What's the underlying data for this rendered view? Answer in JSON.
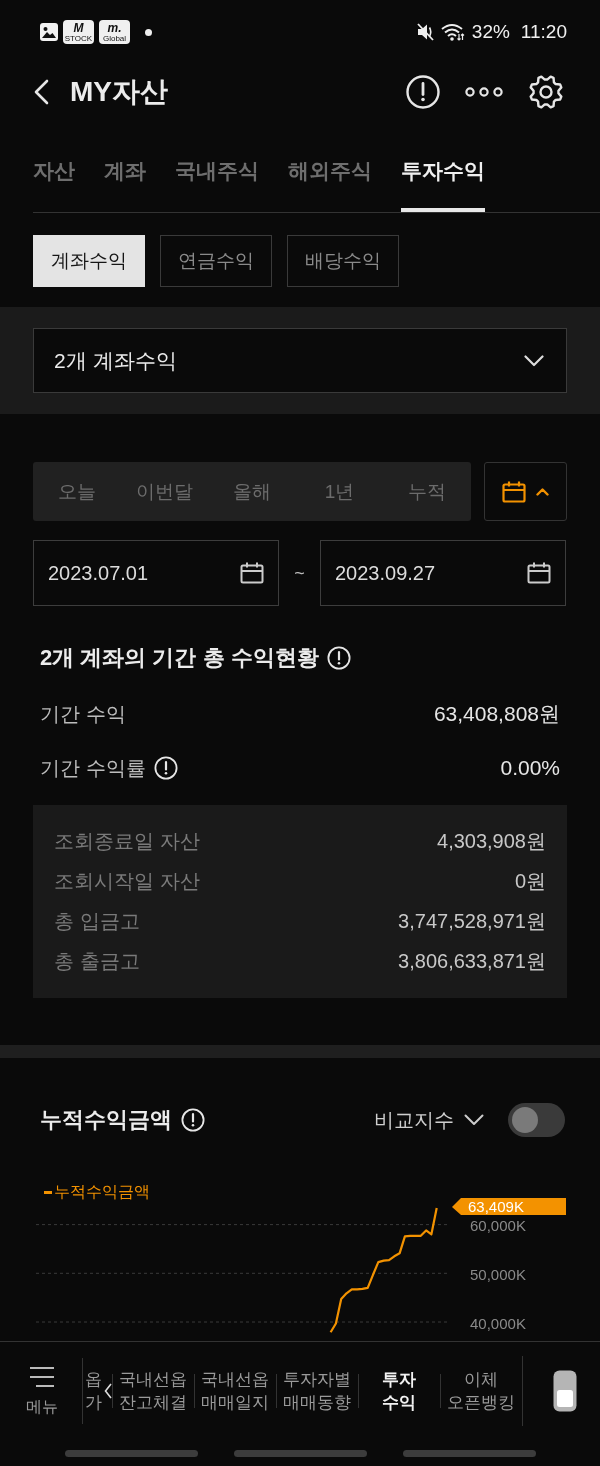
{
  "status_bar": {
    "notification_icons": [
      {
        "kind": "gallery"
      },
      {
        "kind": "app",
        "title": "M",
        "subtitle": "STOCK"
      },
      {
        "kind": "app",
        "title": "m.",
        "subtitle": "Global"
      },
      {
        "kind": "dot"
      }
    ],
    "battery": "32%",
    "time": "11:20"
  },
  "header": {
    "title": "MY자산"
  },
  "tabs": [
    {
      "label": "자산",
      "selected": false
    },
    {
      "label": "계좌",
      "selected": false
    },
    {
      "label": "국내주식",
      "selected": false
    },
    {
      "label": "해외주식",
      "selected": false
    },
    {
      "label": "투자수익",
      "selected": true
    }
  ],
  "sub_tabs": [
    {
      "label": "계좌수익",
      "selected": true
    },
    {
      "label": "연금수익",
      "selected": false
    },
    {
      "label": "배당수익",
      "selected": false
    }
  ],
  "account_dropdown": {
    "value": "2개 계좌수익"
  },
  "period": {
    "options": [
      {
        "label": "오늘",
        "selected": false
      },
      {
        "label": "이번달",
        "selected": false
      },
      {
        "label": "올해",
        "selected": false
      },
      {
        "label": "1년",
        "selected": false
      },
      {
        "label": "누적",
        "selected": false
      }
    ],
    "calendar_toggle": {
      "expanded": true
    },
    "start_date": "2023.07.01",
    "separator": "~",
    "end_date": "2023.09.27"
  },
  "summary": {
    "title": "2개 계좌의 기간 총 수익현황",
    "rows": [
      {
        "label": "기간 수익",
        "value": "63,408,808원",
        "info": false
      },
      {
        "label": "기간 수익률",
        "value": "0.00%",
        "info": true
      }
    ],
    "details": [
      {
        "label": "조회종료일 자산",
        "value": "4,303,908원"
      },
      {
        "label": "조회시작일 자산",
        "value": "0원"
      },
      {
        "label": "총 입금고",
        "value": "3,747,528,971원"
      },
      {
        "label": "총 출금고",
        "value": "3,806,633,871원"
      }
    ]
  },
  "chart_section": {
    "title": "누적수익금액",
    "compare": {
      "label": "비교지수",
      "on": false
    },
    "chart_data": {
      "type": "line",
      "categories": [
        null,
        null,
        null,
        null,
        null,
        null,
        null,
        null,
        null,
        null,
        null,
        null,
        null,
        null,
        null,
        null,
        null,
        null,
        null,
        null,
        null,
        null,
        null,
        null,
        null,
        null,
        null,
        null,
        null,
        null,
        null,
        null,
        null,
        null,
        null,
        null,
        null,
        null,
        null,
        null,
        null,
        null,
        null,
        null,
        null,
        null,
        null,
        null,
        null,
        null,
        null,
        null,
        null,
        null,
        null,
        null,
        null,
        null,
        null,
        null,
        null,
        null,
        null,
        null,
        null,
        null,
        null,
        null,
        null,
        null,
        null,
        null,
        null,
        null,
        null,
        null,
        null,
        null
      ],
      "series": [
        {
          "name": "누적수익금액",
          "color": "#f39200",
          "values": [
            null,
            null,
            null,
            null,
            null,
            null,
            null,
            null,
            null,
            null,
            null,
            null,
            null,
            null,
            null,
            null,
            null,
            null,
            null,
            null,
            null,
            null,
            null,
            null,
            null,
            null,
            null,
            null,
            null,
            null,
            null,
            null,
            null,
            null,
            null,
            null,
            null,
            null,
            null,
            null,
            null,
            null,
            null,
            null,
            null,
            null,
            null,
            null,
            null,
            null,
            null,
            null,
            null,
            null,
            null,
            37900,
            39700,
            44700,
            45900,
            46700,
            46700,
            46800,
            47000,
            49700,
            52300,
            52600,
            52700,
            53500,
            54100,
            57600,
            57700,
            57700,
            57700,
            58800,
            58000,
            63400,
            null,
            null
          ]
        }
      ],
      "ylim": [
        36000,
        63409
      ],
      "yticks": [
        {
          "value": 40000,
          "label": "40,000K"
        },
        {
          "value": 50000,
          "label": "50,000K"
        },
        {
          "value": 60000,
          "label": "60,000K"
        },
        {
          "value": 63409,
          "label": "63,409K"
        }
      ],
      "grid": true
    }
  },
  "bottom_nav": {
    "menu_label": "메뉴",
    "items": [
      {
        "lines": [
          "옵",
          "가"
        ],
        "selected": false
      },
      {
        "lines": [
          "국내선옵",
          "잔고체결"
        ],
        "selected": false
      },
      {
        "lines": [
          "국내선옵",
          "매매일지"
        ],
        "selected": false
      },
      {
        "lines": [
          "투자자별",
          "매매동향"
        ],
        "selected": false
      },
      {
        "lines": [
          "투자",
          "수익"
        ],
        "selected": true
      },
      {
        "lines": [
          "이체",
          "오픈뱅킹"
        ],
        "selected": false
      }
    ]
  }
}
